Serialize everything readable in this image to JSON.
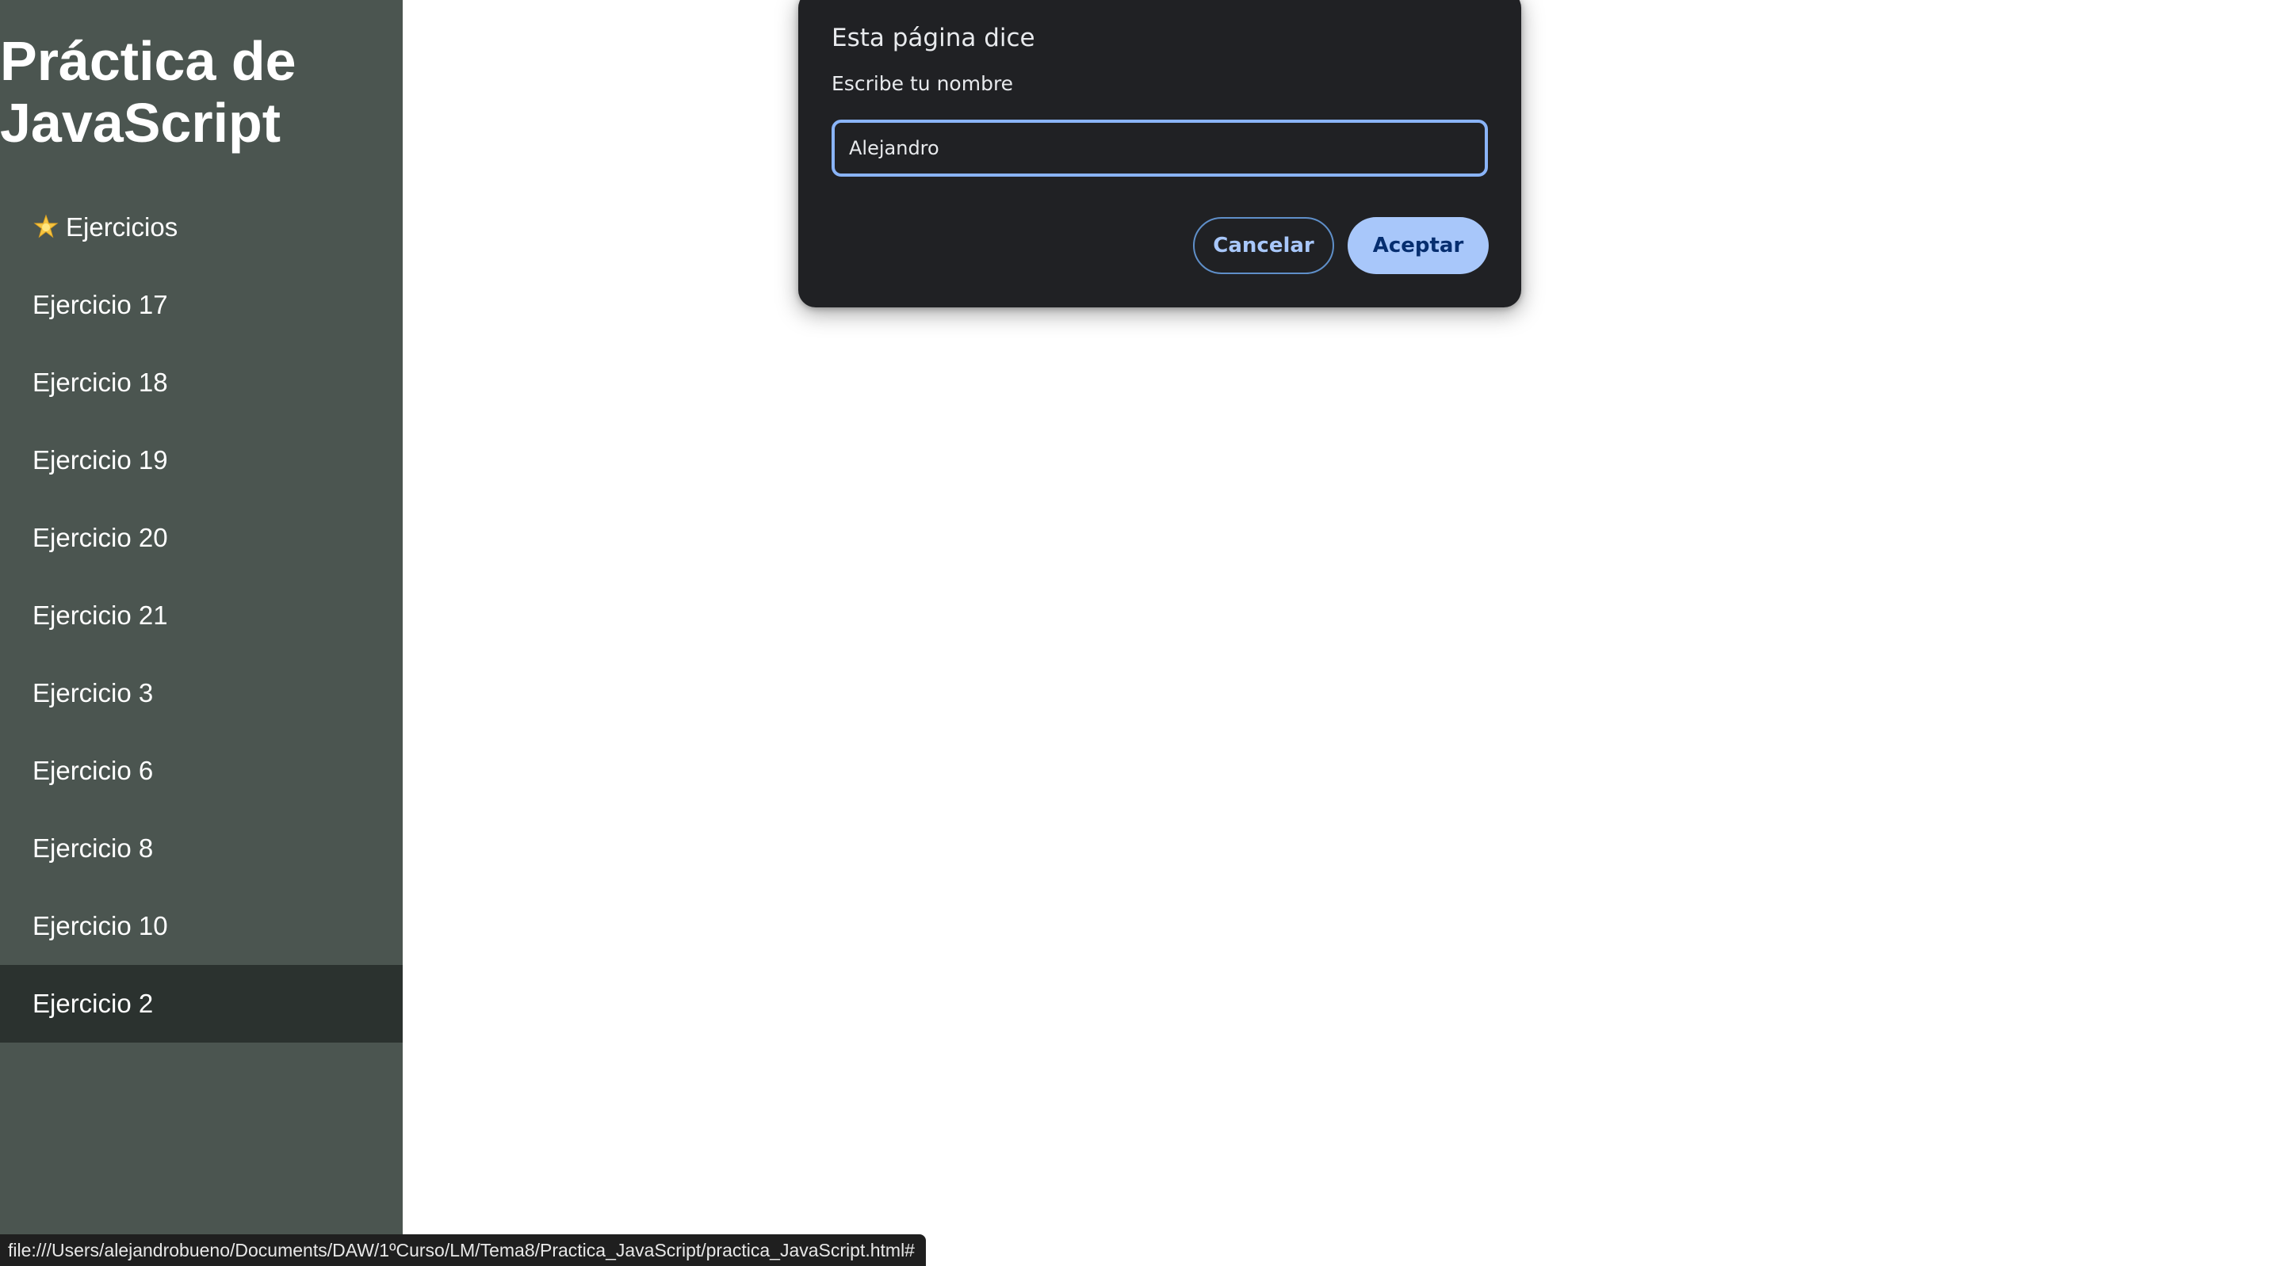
{
  "page": {
    "title": "Práctica de JavaScript"
  },
  "sidebar": {
    "header": {
      "icon": "star-icon",
      "label": "Ejercicios"
    },
    "items": [
      {
        "label": "Ejercicio 17",
        "active": false
      },
      {
        "label": "Ejercicio 18",
        "active": false
      },
      {
        "label": "Ejercicio 19",
        "active": false
      },
      {
        "label": "Ejercicio 20",
        "active": false
      },
      {
        "label": "Ejercicio 21",
        "active": false
      },
      {
        "label": "Ejercicio 3",
        "active": false
      },
      {
        "label": "Ejercicio 6",
        "active": false
      },
      {
        "label": "Ejercicio 8",
        "active": false
      },
      {
        "label": "Ejercicio 10",
        "active": false
      },
      {
        "label": "Ejercicio 2",
        "active": true
      }
    ]
  },
  "dialog": {
    "title": "Esta página dice",
    "message": "Escribe tu nombre",
    "input_value": "Alejandro",
    "cancel_label": "Cancelar",
    "ok_label": "Aceptar"
  },
  "status_bar": {
    "url": "file:///Users/alejandrobueno/Documents/DAW/1ºCurso/LM/Tema8/Practica_JavaScript/practica_JavaScript.html#"
  },
  "colors": {
    "sidebar_bg": "#4b5550",
    "sidebar_active_bg": "#2b322f",
    "dialog_bg": "#202124",
    "accent": "#a8c7fa"
  }
}
